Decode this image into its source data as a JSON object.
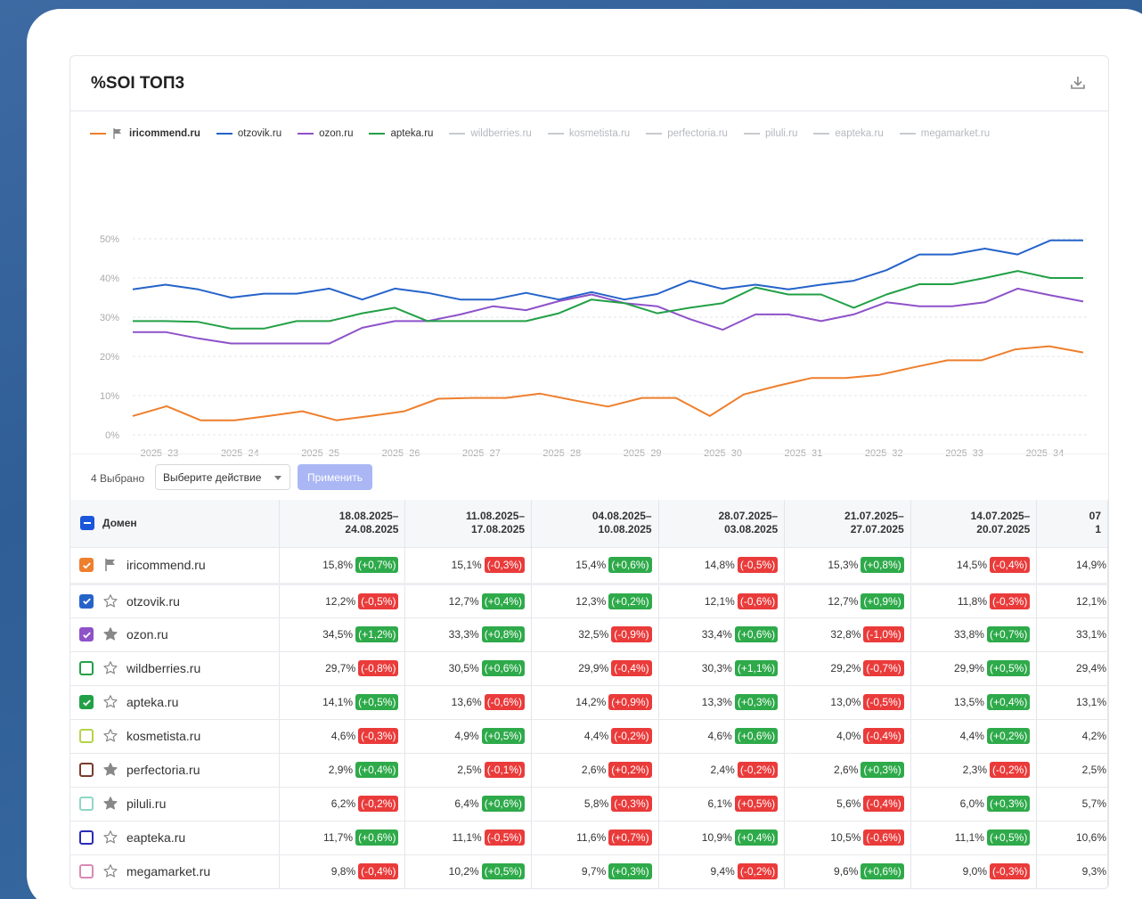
{
  "card": {
    "title": "%SOI ТОП3"
  },
  "legend": [
    {
      "label": "iricommend.ru",
      "color": "#ee7f2d",
      "active": true,
      "flag": true
    },
    {
      "label": "otzovik.ru",
      "color": "#2563c9",
      "active": true
    },
    {
      "label": "ozon.ru",
      "color": "#8e52c9",
      "active": true
    },
    {
      "label": "apteka.ru",
      "color": "#22a046",
      "active": true
    },
    {
      "label": "wildberries.ru",
      "color": "#c7cace",
      "active": false
    },
    {
      "label": "kosmetista.ru",
      "color": "#c7cace",
      "active": false
    },
    {
      "label": "perfectoria.ru",
      "color": "#c7cace",
      "active": false
    },
    {
      "label": "piluli.ru",
      "color": "#c7cace",
      "active": false
    },
    {
      "label": "eapteka.ru",
      "color": "#c7cace",
      "active": false
    },
    {
      "label": "megamarket.ru",
      "color": "#c7cace",
      "active": false
    }
  ],
  "chart_data": {
    "type": "line",
    "title": "%SOI ТОП3",
    "y_ticks": [
      "0%",
      "10%",
      "20%",
      "30%",
      "40%",
      "50%"
    ],
    "ylim": [
      0,
      50
    ],
    "x_tick_labels": [
      "2025_23",
      "2025_24",
      "2025_25",
      "2025_26",
      "2025_27",
      "2025_28",
      "2025_29",
      "2025_30",
      "2025_31",
      "2025_32",
      "2025_33",
      "2025_34"
    ],
    "x_count": 24,
    "grid": true,
    "series": [
      {
        "name": "iricommend.ru",
        "color": "#ee7f2d",
        "values": [
          4.8,
          7.3,
          3.7,
          3.7,
          4.8,
          6,
          3.7,
          4.8,
          6,
          9.2,
          9.4,
          9.4,
          10.5,
          8.8,
          7.2,
          9.4,
          9.4,
          4.8,
          10.3,
          12.5,
          14.5,
          14.5,
          15.3,
          17.2,
          19,
          19,
          21.8,
          22.6,
          21
        ]
      },
      {
        "name": "otzovik.ru",
        "color": "#2563c9",
        "values": [
          37.1,
          38.3,
          37.1,
          35,
          36,
          36,
          37.3,
          34.5,
          37.3,
          36.2,
          34.5,
          34.5,
          36.2,
          34.5,
          36.4,
          34.5,
          35.9,
          39.3,
          37.2,
          38.3,
          37.1,
          38.3,
          39.3,
          42,
          46,
          46,
          47.5,
          46,
          49.6,
          49.6
        ]
      },
      {
        "name": "ozon.ru",
        "color": "#8e52c9",
        "values": [
          26.2,
          26.2,
          24.6,
          23.3,
          23.3,
          23.3,
          23.3,
          27.3,
          29,
          29,
          30.7,
          32.8,
          31.8,
          34.1,
          35.8,
          33.6,
          32.8,
          29.5,
          26.8,
          30.7,
          30.7,
          29,
          30.7,
          33.8,
          32.8,
          32.8,
          33.8,
          37.3,
          35.6,
          34
        ]
      },
      {
        "name": "apteka.ru",
        "color": "#22a046",
        "values": [
          29,
          29,
          28.8,
          27.1,
          27.1,
          29,
          29,
          31,
          32.4,
          29,
          29,
          29,
          29,
          31,
          34.5,
          33.6,
          31,
          32.4,
          33.6,
          37.6,
          35.8,
          35.8,
          32.4,
          35.8,
          38.4,
          38.4,
          40,
          41.8,
          40,
          40
        ]
      }
    ]
  },
  "toolbar": {
    "selected_count": "4 Выбрано",
    "action_placeholder": "Выберите действие",
    "apply_label": "Применить"
  },
  "table": {
    "domain_header": "Домен",
    "date_headers": [
      [
        "18.08.2025–",
        "24.08.2025"
      ],
      [
        "11.08.2025–",
        "17.08.2025"
      ],
      [
        "04.08.2025–",
        "10.08.2025"
      ],
      [
        "28.07.2025–",
        "03.08.2025"
      ],
      [
        "21.07.2025–",
        "27.07.2025"
      ],
      [
        "14.07.2025–",
        "20.07.2025"
      ],
      [
        "07",
        "1"
      ]
    ],
    "rows": [
      {
        "domain": "iricommend.ru",
        "checkbox_color": "#ee7f2d",
        "checked": true,
        "icon": "flag",
        "pinned": true,
        "cells": [
          [
            "15,8%",
            "(+0,7%)",
            "pos"
          ],
          [
            "15,1%",
            "(-0,3%)",
            "neg"
          ],
          [
            "15,4%",
            "(+0,6%)",
            "pos"
          ],
          [
            "14,8%",
            "(-0,5%)",
            "neg"
          ],
          [
            "15,3%",
            "(+0,8%)",
            "pos"
          ],
          [
            "14,5%",
            "(-0,4%)",
            "neg"
          ],
          [
            "14,9%",
            "",
            ""
          ]
        ]
      },
      {
        "domain": "otzovik.ru",
        "checkbox_color": "#2563c9",
        "checked": true,
        "icon": "star-outline",
        "cells": [
          [
            "12,2%",
            "(-0,5%)",
            "neg"
          ],
          [
            "12,7%",
            "(+0,4%)",
            "pos"
          ],
          [
            "12,3%",
            "(+0,2%)",
            "pos"
          ],
          [
            "12,1%",
            "(-0,6%)",
            "neg"
          ],
          [
            "12,7%",
            "(+0,9%)",
            "pos"
          ],
          [
            "11,8%",
            "(-0,3%)",
            "neg"
          ],
          [
            "12,1%",
            "",
            ""
          ]
        ]
      },
      {
        "domain": "ozon.ru",
        "checkbox_color": "#8e52c9",
        "checked": true,
        "icon": "star-filled",
        "cells": [
          [
            "34,5%",
            "(+1,2%)",
            "pos"
          ],
          [
            "33,3%",
            "(+0,8%)",
            "pos"
          ],
          [
            "32,5%",
            "(-0,9%)",
            "neg"
          ],
          [
            "33,4%",
            "(+0,6%)",
            "pos"
          ],
          [
            "32,8%",
            "(-1,0%)",
            "neg"
          ],
          [
            "33,8%",
            "(+0,7%)",
            "pos"
          ],
          [
            "33,1%",
            "",
            ""
          ]
        ]
      },
      {
        "domain": "wildberries.ru",
        "checkbox_color": "#22a046",
        "checked": false,
        "icon": "star-outline",
        "cells": [
          [
            "29,7%",
            "(-0,8%)",
            "neg"
          ],
          [
            "30,5%",
            "(+0,6%)",
            "pos"
          ],
          [
            "29,9%",
            "(-0,4%)",
            "neg"
          ],
          [
            "30,3%",
            "(+1,1%)",
            "pos"
          ],
          [
            "29,2%",
            "(-0,7%)",
            "neg"
          ],
          [
            "29,9%",
            "(+0,5%)",
            "pos"
          ],
          [
            "29,4%",
            "",
            ""
          ]
        ]
      },
      {
        "domain": "apteka.ru",
        "checkbox_color": "#22a046",
        "checked": true,
        "icon": "star-outline",
        "cells": [
          [
            "14,1%",
            "(+0,5%)",
            "pos"
          ],
          [
            "13,6%",
            "(-0,6%)",
            "neg"
          ],
          [
            "14,2%",
            "(+0,9%)",
            "neg"
          ],
          [
            "13,3%",
            "(+0,3%)",
            "pos"
          ],
          [
            "13,0%",
            "(-0,5%)",
            "neg"
          ],
          [
            "13,5%",
            "(+0,4%)",
            "pos"
          ],
          [
            "13,1%",
            "",
            ""
          ]
        ]
      },
      {
        "domain": "kosmetista.ru",
        "checkbox_color": "#b4d44a",
        "checked": false,
        "icon": "star-outline",
        "cells": [
          [
            "4,6%",
            "(-0,3%)",
            "neg"
          ],
          [
            "4,9%",
            "(+0,5%)",
            "pos"
          ],
          [
            "4,4%",
            "(-0,2%)",
            "neg"
          ],
          [
            "4,6%",
            "(+0,6%)",
            "pos"
          ],
          [
            "4,0%",
            "(-0,4%)",
            "neg"
          ],
          [
            "4,4%",
            "(+0,2%)",
            "pos"
          ],
          [
            "4,2%",
            "",
            ""
          ]
        ]
      },
      {
        "domain": "perfectoria.ru",
        "checkbox_color": "#7a3b2e",
        "checked": false,
        "icon": "star-filled",
        "cells": [
          [
            "2,9%",
            "(+0,4%)",
            "pos"
          ],
          [
            "2,5%",
            "(-0,1%)",
            "neg"
          ],
          [
            "2,6%",
            "(+0,2%)",
            "neg"
          ],
          [
            "2,4%",
            "(-0,2%)",
            "neg"
          ],
          [
            "2,6%",
            "(+0,3%)",
            "pos"
          ],
          [
            "2,3%",
            "(-0,2%)",
            "neg"
          ],
          [
            "2,5%",
            "",
            ""
          ]
        ]
      },
      {
        "domain": "piluli.ru",
        "checkbox_color": "#8fd6c8",
        "checked": false,
        "icon": "star-filled",
        "cells": [
          [
            "6,2%",
            "(-0,2%)",
            "neg"
          ],
          [
            "6,4%",
            "(+0,6%)",
            "pos"
          ],
          [
            "5,8%",
            "(-0,3%)",
            "neg"
          ],
          [
            "6,1%",
            "(+0,5%)",
            "neg"
          ],
          [
            "5,6%",
            "(-0,4%)",
            "neg"
          ],
          [
            "6,0%",
            "(+0,3%)",
            "pos"
          ],
          [
            "5,7%",
            "",
            ""
          ]
        ]
      },
      {
        "domain": "eapteka.ru",
        "checkbox_color": "#2a2ab8",
        "checked": false,
        "icon": "star-outline",
        "cells": [
          [
            "11,7%",
            "(+0,6%)",
            "pos"
          ],
          [
            "11,1%",
            "(-0,5%)",
            "neg"
          ],
          [
            "11,6%",
            "(+0,7%)",
            "neg"
          ],
          [
            "10,9%",
            "(+0,4%)",
            "pos"
          ],
          [
            "10,5%",
            "(-0,6%)",
            "neg"
          ],
          [
            "11,1%",
            "(+0,5%)",
            "pos"
          ],
          [
            "10,6%",
            "",
            ""
          ]
        ]
      },
      {
        "domain": "megamarket.ru",
        "checkbox_color": "#d98ab4",
        "checked": false,
        "icon": "star-outline",
        "cells": [
          [
            "9,8%",
            "(-0,4%)",
            "neg"
          ],
          [
            "10,2%",
            "(+0,5%)",
            "pos"
          ],
          [
            "9,7%",
            "(+0,3%)",
            "pos"
          ],
          [
            "9,4%",
            "(-0,2%)",
            "neg"
          ],
          [
            "9,6%",
            "(+0,6%)",
            "pos"
          ],
          [
            "9,0%",
            "(-0,3%)",
            "neg"
          ],
          [
            "9,3%",
            "",
            ""
          ]
        ]
      }
    ]
  }
}
